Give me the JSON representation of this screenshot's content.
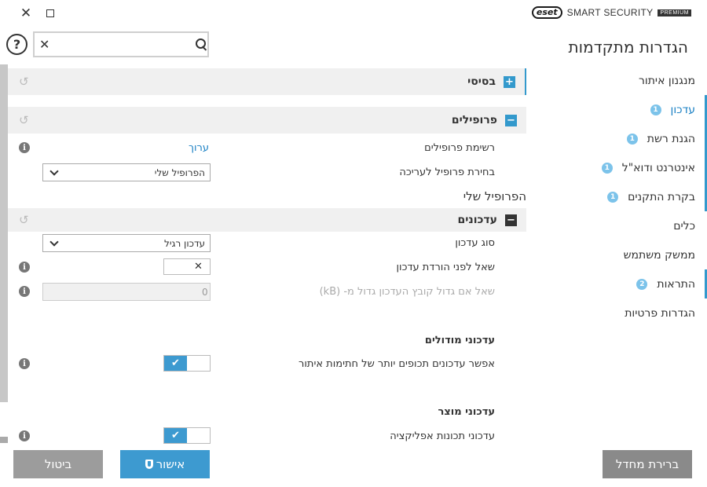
{
  "brand": {
    "logo": "eset",
    "name": "SMART SECURITY",
    "edition": "PREMIUM"
  },
  "sidebar": {
    "title": "הגדרות מתקדמות",
    "items": [
      {
        "label": "מנגנון איתור",
        "badge": ""
      },
      {
        "label": "עדכון",
        "badge": "1"
      },
      {
        "label": "הגנת רשת",
        "badge": "1"
      },
      {
        "label": "אינטרנט ודוא\"ל",
        "badge": "1"
      },
      {
        "label": "בקרת התקנים",
        "badge": "1"
      },
      {
        "label": "כלים",
        "badge": ""
      },
      {
        "label": "ממשק משתמש",
        "badge": ""
      },
      {
        "label": "התראות",
        "badge": "2"
      },
      {
        "label": "הגדרות פרטיות",
        "badge": ""
      }
    ]
  },
  "search": {
    "value": "",
    "placeholder": ""
  },
  "help": {
    "glyph": "?"
  },
  "sections": {
    "basic": {
      "title": "בסיסי",
      "toggle": "+"
    },
    "profiles": {
      "title": "פרופילים",
      "toggle": "−",
      "list_label": "רשימת פרופילים",
      "edit_link": "ערוך",
      "select_label": "בחירת פרופיל לעריכה",
      "select_value": "הפרופיל שלי",
      "current_profile": "הפרופיל שלי"
    },
    "updates": {
      "title": "עדכונים",
      "toggle": "−",
      "type_label": "סוג עדכון",
      "type_value": "עדכון רגיל",
      "ask_label": "שאל לפני הורדת עדכון",
      "size_label": "שאל אם גדול קובץ העדכון גדול מ- (kB)",
      "size_value": "0"
    },
    "module_updates": {
      "title": "עדכוני מודולים",
      "frequent_label": "אפשר עדכונים תכופים יותר של חתימות איתור"
    },
    "product_updates": {
      "title": "עדכוני מוצר",
      "app_label": "עדכוני תכונות אפליקציה"
    }
  },
  "footer": {
    "cancel": "ביטול",
    "ok": "אישור",
    "default": "ברירת מחדל"
  },
  "colors": {
    "accent": "#3399cc",
    "link": "#1a80c4",
    "cancel_btn": "#9c9c9c",
    "default_btn": "#8a8a8a"
  }
}
